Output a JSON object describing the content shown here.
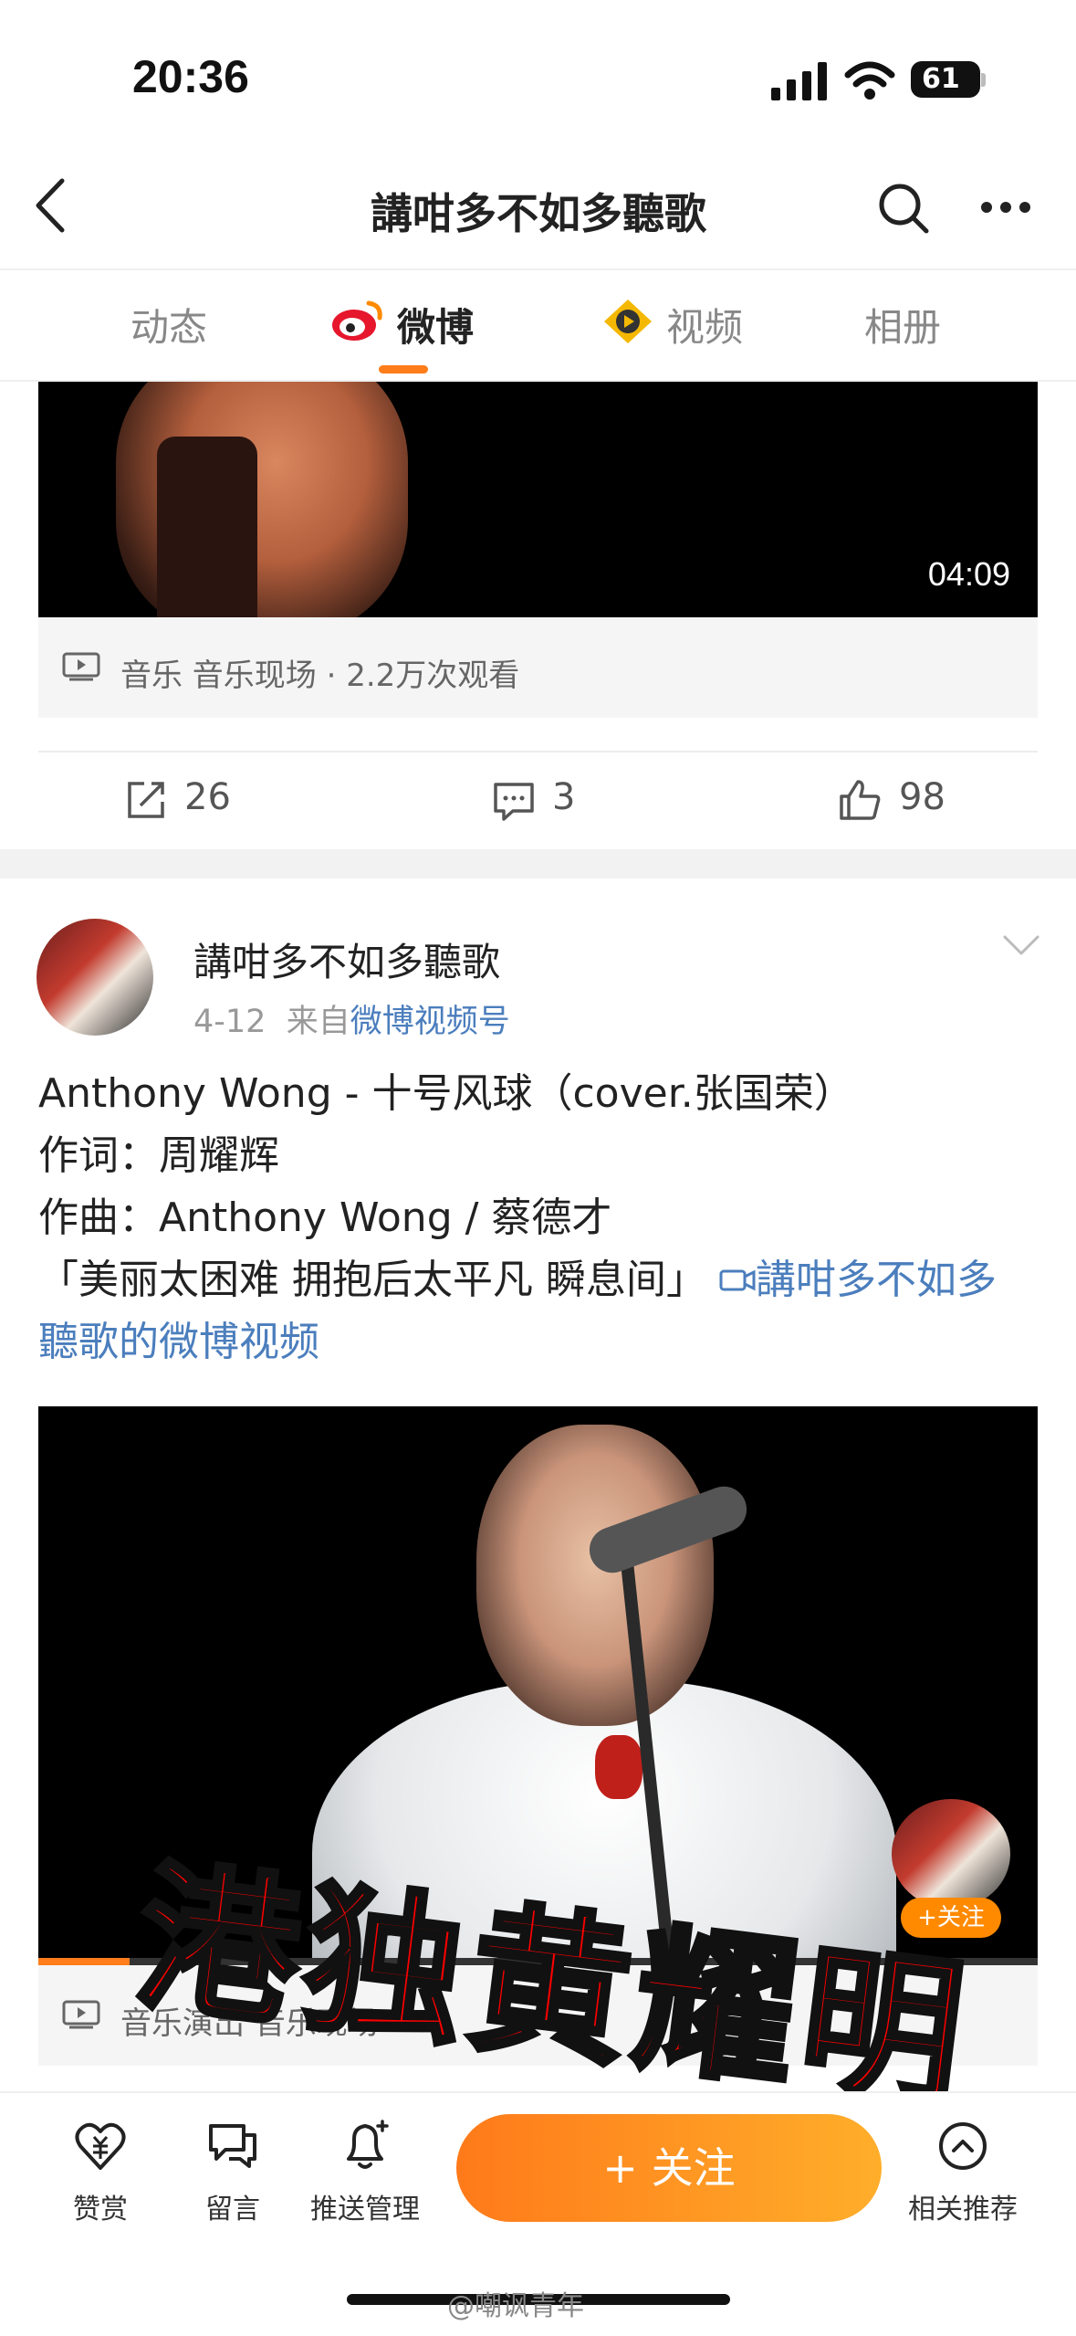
{
  "status_bar": {
    "time": "20:36",
    "battery": "61"
  },
  "nav": {
    "title": "講咁多不如多聽歌"
  },
  "tabs": [
    {
      "label": "动态"
    },
    {
      "label": "微博"
    },
    {
      "label": "视频"
    },
    {
      "label": "相册"
    }
  ],
  "post1": {
    "duration": "04:09",
    "meta": "音乐 音乐现场 · 2.2万次观看",
    "reposts": "26",
    "comments": "3",
    "likes": "98"
  },
  "post2": {
    "author": "講咁多不如多聽歌",
    "date": "4-12",
    "from_prefix": "来自",
    "source": "微博视频号",
    "lines": [
      "Anthony Wong - 十号风球（cover.张国荣）",
      "作词：周耀辉",
      "作曲：Anthony Wong / 蔡德才"
    ],
    "quote": "「美丽太困难 拥抱后太平凡 瞬息间」",
    "link_part1": "講咁多不如多",
    "link_part2": "聽歌的微博视频",
    "video_meta": "音乐演出 音乐现场 · ",
    "mini_follow": "+关注"
  },
  "overlay_text": "港独黄耀明",
  "bottom_bar": {
    "reward": "赞赏",
    "message": "留言",
    "push": "推送管理",
    "follow": "+ 关注",
    "related": "相关推荐"
  },
  "watermark": "@嘲讽青年"
}
